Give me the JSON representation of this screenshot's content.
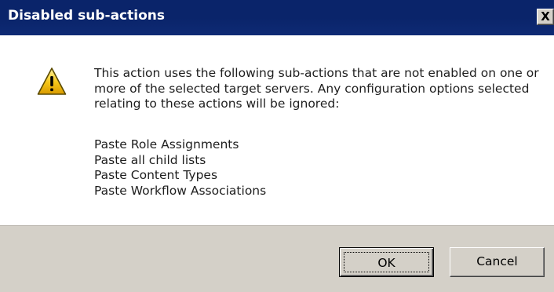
{
  "window": {
    "title": "Disabled sub-actions",
    "close_label": "X"
  },
  "icon": {
    "name": "warning-icon",
    "colors": {
      "fill": "#f5c518",
      "outline": "#5a4a00",
      "glyph": "#000000"
    }
  },
  "message": {
    "text": "This action uses the following sub-actions that are not enabled on one or more of the selected target servers. Any configuration options selected relating to these actions will be ignored:"
  },
  "sub_actions": [
    "Paste Role Assignments",
    "Paste all child lists",
    "Paste Content Types",
    "Paste Workflow Associations"
  ],
  "buttons": {
    "ok_label": "OK",
    "cancel_label": "Cancel"
  },
  "colors": {
    "title_bar": "#0a246a",
    "title_text": "#ffffff",
    "footer": "#d4d0c8",
    "content": "#ffffff"
  }
}
